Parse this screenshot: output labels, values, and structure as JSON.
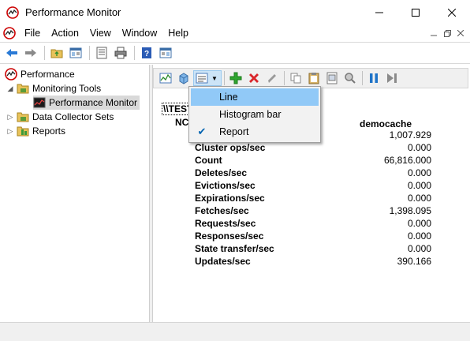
{
  "window": {
    "title": "Performance Monitor"
  },
  "menu": {
    "items": [
      "File",
      "Action",
      "View",
      "Window",
      "Help"
    ]
  },
  "tree": {
    "items": [
      {
        "label": "Performance",
        "icon": "perfmon-icon"
      },
      {
        "label": "Monitoring Tools",
        "icon": "folder-icon"
      },
      {
        "label": "Performance Monitor",
        "icon": "chart-icon"
      },
      {
        "label": "Data Collector Sets",
        "icon": "folder-icon"
      },
      {
        "label": "Reports",
        "icon": "reports-icon"
      }
    ]
  },
  "dropdown": {
    "items": [
      {
        "label": "Line",
        "checked": false,
        "highlighted": true
      },
      {
        "label": "Histogram bar",
        "checked": false,
        "highlighted": false
      },
      {
        "label": "Report",
        "checked": true,
        "highlighted": false
      }
    ]
  },
  "report": {
    "computer": "\\\\TEST",
    "object": "NC",
    "instance": "democache",
    "rows": [
      {
        "label": "Cluster ops/sec",
        "value": "0.000"
      },
      {
        "label": "Count",
        "value": "66,816.000"
      },
      {
        "label": "Deletes/sec",
        "value": "0.000"
      },
      {
        "label": "Evictions/sec",
        "value": "0.000"
      },
      {
        "label": "Expirations/sec",
        "value": "0.000"
      },
      {
        "label": "Fetches/sec",
        "value": "1,398.095"
      },
      {
        "label": "Requests/sec",
        "value": "0.000"
      },
      {
        "label": "Responses/sec",
        "value": "0.000"
      },
      {
        "label": "State transfer/sec",
        "value": "0.000"
      },
      {
        "label": "Updates/sec",
        "value": "390.166"
      }
    ],
    "partial_first_value": "1,007.929"
  },
  "colors": {
    "accent": "#0063b1",
    "highlight": "#91c9f7",
    "pressed": "#cce4f7"
  }
}
